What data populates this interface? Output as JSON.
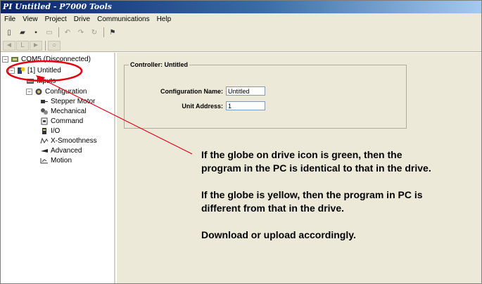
{
  "window": {
    "title": "PI Untitled - P7000 Tools"
  },
  "menu": {
    "items": [
      "File",
      "View",
      "Project",
      "Drive",
      "Communications",
      "Help"
    ]
  },
  "toolbar1": {
    "buttons": [
      {
        "icon": "new-file-icon",
        "glyph": "▯"
      },
      {
        "icon": "open-folder-icon",
        "glyph": "▰"
      },
      {
        "icon": "save-icon",
        "glyph": "▪"
      },
      {
        "icon": "print-icon",
        "glyph": "▭"
      },
      {
        "icon": "undo-icon",
        "glyph": "↶"
      },
      {
        "icon": "redo-icon",
        "glyph": "↷"
      },
      {
        "icon": "refresh-icon",
        "glyph": "↻"
      },
      {
        "icon": "compile-icon",
        "glyph": "⚑"
      }
    ]
  },
  "toolbar2": {
    "buttons": [
      {
        "icon": "step-back-icon",
        "glyph": "◄"
      },
      {
        "icon": "left-icon",
        "glyph": "L"
      },
      {
        "icon": "forward-icon",
        "glyph": "►"
      },
      {
        "icon": "stop-icon",
        "glyph": "○"
      }
    ]
  },
  "tree": {
    "port": "COM5 (Disconnected)",
    "drive": "[1] Untitled",
    "inputs": "Inputs",
    "configuration": "Configuration",
    "children": [
      "Stepper Motor",
      "Mechanical",
      "Command",
      "I/O",
      "X-Smoothness",
      "Advanced",
      "Motion"
    ]
  },
  "controller": {
    "legend": "Controller: Untitled",
    "config_name_label": "Configuration Name:",
    "config_name_value": "Untitled",
    "unit_address_label": "Unit Address:",
    "unit_address_value": "1"
  },
  "note": {
    "p1": "If the globe on drive icon is green, then the program in the PC is identical to that in the drive.",
    "p2": "If the globe is yellow, then the program in PC is different from that in the drive.",
    "p3": "Download or upload accordingly."
  },
  "colors": {
    "annotation": "#e4000f",
    "titlebar": "#0a246a",
    "panel": "#ece9d8"
  }
}
